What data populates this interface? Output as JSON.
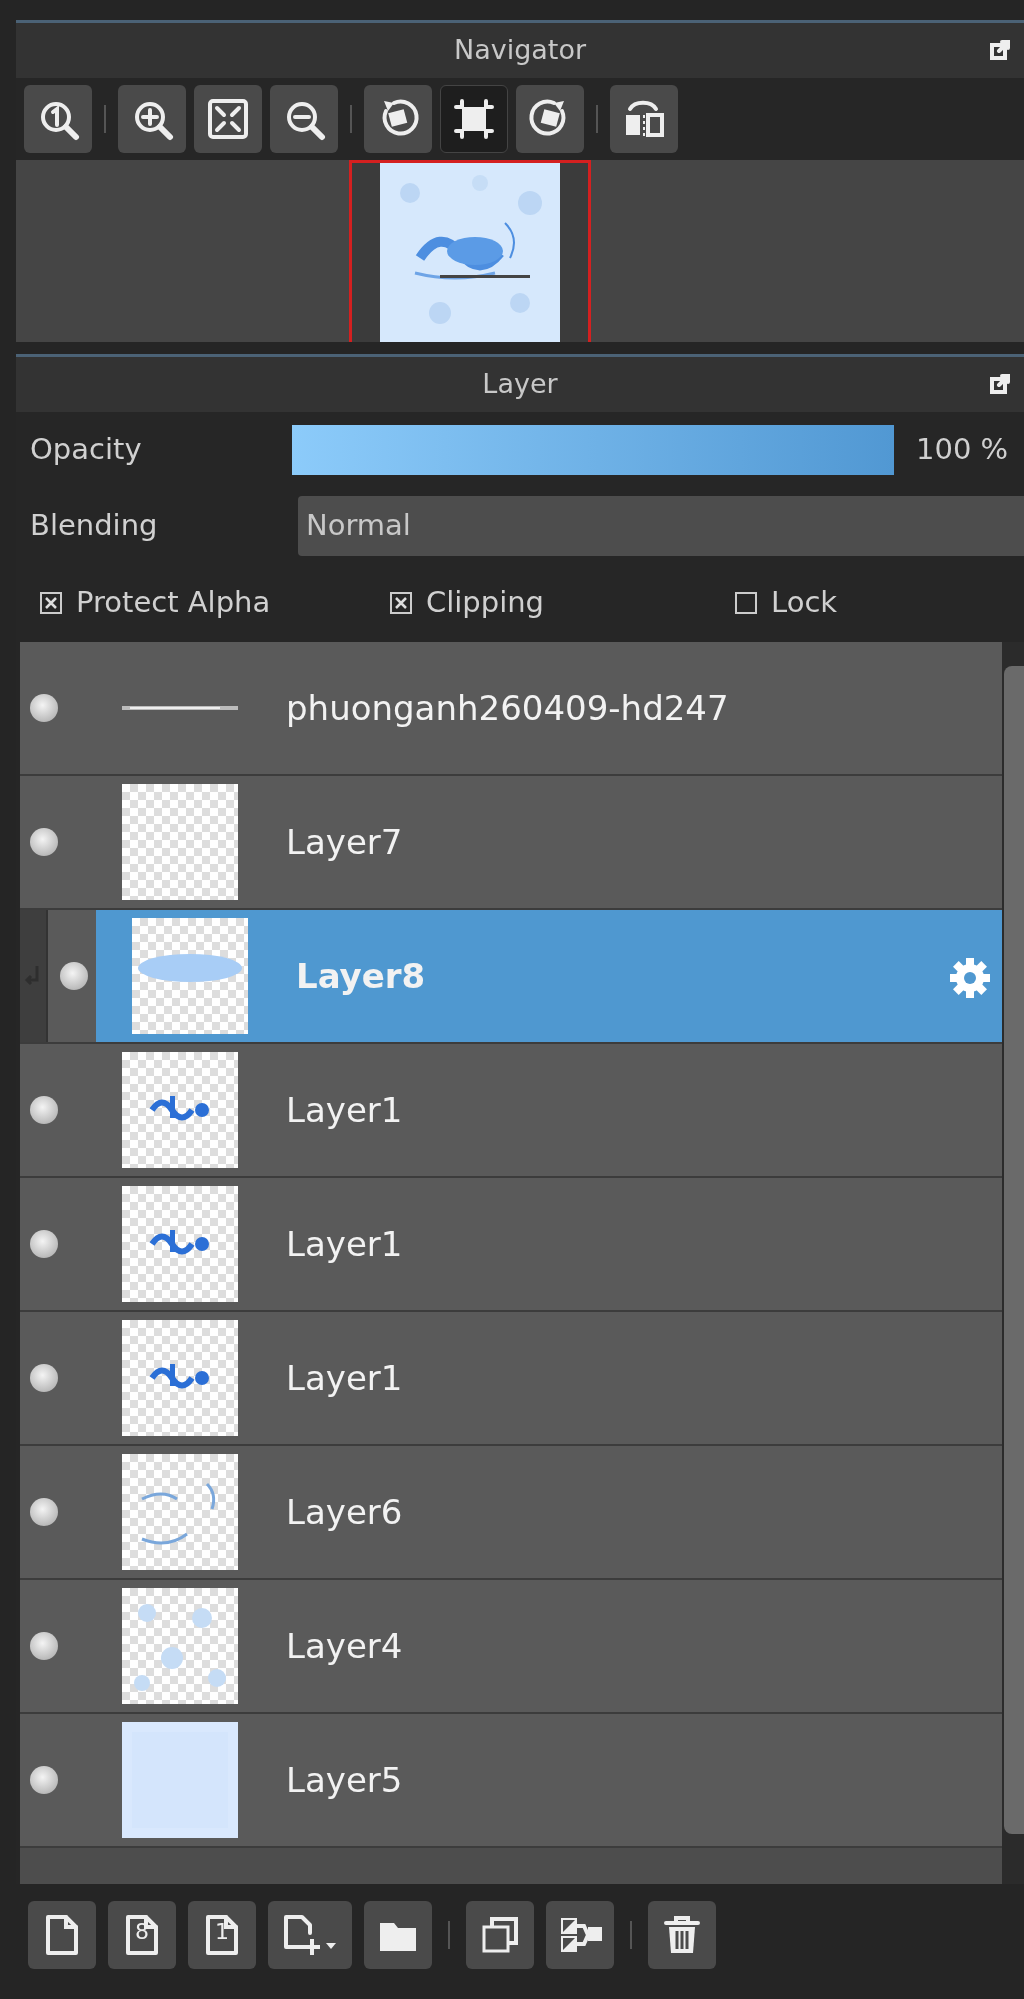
{
  "navigator": {
    "title": "Navigator",
    "tools": [
      {
        "selected": false
      },
      {
        "selected": false
      },
      {
        "selected": false
      },
      {
        "selected": false
      },
      {
        "selected": false
      },
      {
        "selected": true
      },
      {
        "selected": false
      },
      {
        "selected": false
      }
    ]
  },
  "layer_panel": {
    "title": "Layer",
    "opacity": {
      "label": "Opacity",
      "level": 1,
      "reading": "100 %"
    },
    "blending": {
      "label": "Blending",
      "value": "Normal"
    },
    "options": [
      {
        "label": "Protect Alpha",
        "checked": true
      },
      {
        "label": "Clipping",
        "checked": true
      },
      {
        "label": "Lock",
        "checked": false
      }
    ],
    "layers": [
      {
        "name": "phuonganh260409-hd247",
        "visible": true,
        "selected": false,
        "clipping": false
      },
      {
        "name": "Layer7",
        "visible": true,
        "selected": false,
        "clipping": false
      },
      {
        "name": "Layer8",
        "visible": true,
        "selected": true,
        "clipping": true
      },
      {
        "name": "Layer1",
        "visible": true,
        "selected": false,
        "clipping": false
      },
      {
        "name": "Layer1",
        "visible": true,
        "selected": false,
        "clipping": false
      },
      {
        "name": "Layer1",
        "visible": true,
        "selected": false,
        "clipping": false
      },
      {
        "name": "Layer6",
        "visible": true,
        "selected": false,
        "clipping": false
      },
      {
        "name": "Layer4",
        "visible": true,
        "selected": false,
        "clipping": false
      },
      {
        "name": "Layer5",
        "visible": true,
        "selected": false,
        "clipping": false
      }
    ],
    "toolbar_glyphs": [
      "8",
      "1"
    ]
  }
}
